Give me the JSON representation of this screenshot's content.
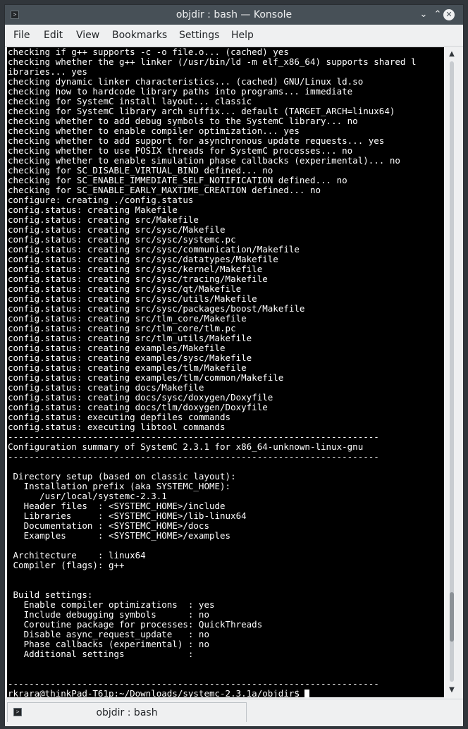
{
  "window": {
    "title": "objdir : bash — Konsole",
    "app_icon": ">",
    "minimize_glyph": "⌄",
    "maximize_glyph": "⌃",
    "close_glyph": "✕"
  },
  "menu": {
    "file": "File",
    "edit": "Edit",
    "view": "View",
    "bookmarks": "Bookmarks",
    "settings": "Settings",
    "help": "Help"
  },
  "terminal": {
    "lines": [
      "checking if g++ supports -c -o file.o... (cached) yes",
      "checking whether the g++ linker (/usr/bin/ld -m elf_x86_64) supports shared l",
      "ibraries... yes",
      "checking dynamic linker characteristics... (cached) GNU/Linux ld.so",
      "checking how to hardcode library paths into programs... immediate",
      "checking for SystemC install layout... classic",
      "checking for SystemC library arch suffix... default (TARGET_ARCH=linux64)",
      "checking whether to add debug symbols to the SystemC library... no",
      "checking whether to enable compiler optimization... yes",
      "checking whether to add support for asynchronous update requests... yes",
      "checking whether to use POSIX threads for SystemC processes... no",
      "checking whether to enable simulation phase callbacks (experimental)... no",
      "checking for SC_DISABLE_VIRTUAL_BIND defined... no",
      "checking for SC_ENABLE_IMMEDIATE_SELF_NOTIFICATION defined... no",
      "checking for SC_ENABLE_EARLY_MAXTIME_CREATION defined... no",
      "configure: creating ./config.status",
      "config.status: creating Makefile",
      "config.status: creating src/Makefile",
      "config.status: creating src/sysc/Makefile",
      "config.status: creating src/sysc/systemc.pc",
      "config.status: creating src/sysc/communication/Makefile",
      "config.status: creating src/sysc/datatypes/Makefile",
      "config.status: creating src/sysc/kernel/Makefile",
      "config.status: creating src/sysc/tracing/Makefile",
      "config.status: creating src/sysc/qt/Makefile",
      "config.status: creating src/sysc/utils/Makefile",
      "config.status: creating src/sysc/packages/boost/Makefile",
      "config.status: creating src/tlm_core/Makefile",
      "config.status: creating src/tlm_core/tlm.pc",
      "config.status: creating src/tlm_utils/Makefile",
      "config.status: creating examples/Makefile",
      "config.status: creating examples/sysc/Makefile",
      "config.status: creating examples/tlm/Makefile",
      "config.status: creating examples/tlm/common/Makefile",
      "config.status: creating docs/Makefile",
      "config.status: creating docs/sysc/doxygen/Doxyfile",
      "config.status: creating docs/tlm/doxygen/Doxyfile",
      "config.status: executing depfiles commands",
      "config.status: executing libtool commands",
      "----------------------------------------------------------------------",
      "Configuration summary of SystemC 2.3.1 for x86_64-unknown-linux-gnu",
      "----------------------------------------------------------------------",
      "",
      " Directory setup (based on classic layout):",
      "   Installation prefix (aka SYSTEMC_HOME):",
      "      /usr/local/systemc-2.3.1",
      "   Header files  : <SYSTEMC_HOME>/include",
      "   Libraries     : <SYSTEMC_HOME>/lib-linux64",
      "   Documentation : <SYSTEMC_HOME>/docs",
      "   Examples      : <SYSTEMC_HOME>/examples",
      "",
      " Architecture    : linux64",
      " Compiler (flags): g++",
      "",
      "",
      " Build settings:",
      "   Enable compiler optimizations  : yes",
      "   Include debugging symbols      : no",
      "   Coroutine package for processes: QuickThreads",
      "   Disable async_request_update   : no",
      "   Phase callbacks (experimental) : no",
      "   Additional settings            :",
      "",
      "",
      "----------------------------------------------------------------------"
    ],
    "prompt": "rkrara@thinkPad-T61p:~/Downloads/systemc-2.3.1a/objdir$ "
  },
  "scrollbar": {
    "up_glyph": "▲",
    "down_glyph": "▼",
    "position": 0.93
  },
  "tabs": [
    {
      "icon": ">",
      "label": "objdir : bash"
    }
  ]
}
